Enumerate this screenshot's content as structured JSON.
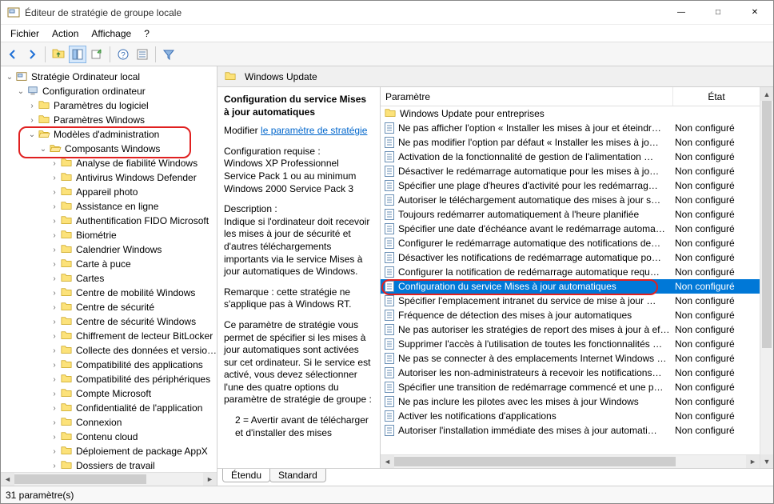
{
  "window": {
    "title": "Éditeur de stratégie de groupe locale"
  },
  "menu": {
    "items": [
      "Fichier",
      "Action",
      "Affichage",
      "?"
    ]
  },
  "tree": {
    "root": "Stratégie Ordinateur local",
    "config_computer": "Configuration ordinateur",
    "params_logiciel": "Paramètres du logiciel",
    "params_windows": "Paramètres Windows",
    "modeles_admin": "Modèles d'administration",
    "composants_windows": "Composants Windows",
    "children": [
      "Analyse de fiabilité Windows",
      "Antivirus Windows Defender",
      "Appareil photo",
      "Assistance en ligne",
      "Authentification FIDO Microsoft",
      "Biométrie",
      "Calendrier Windows",
      "Carte à puce",
      "Cartes",
      "Centre de mobilité Windows",
      "Centre de sécurité",
      "Centre de sécurité Windows",
      "Chiffrement de lecteur BitLocker",
      "Collecte des données et versions",
      "Compatibilité des applications",
      "Compatibilité des périphériques",
      "Compte Microsoft",
      "Confidentialité de l'application",
      "Connexion",
      "Contenu cloud",
      "Déploiement de package AppX",
      "Dossiers de travail"
    ]
  },
  "right": {
    "header": "Windows Update",
    "desc_title": "Configuration du service Mises à jour automatiques",
    "edit_label": "Modifier",
    "edit_link": "le paramètre de stratégie",
    "req_label": "Configuration requise :",
    "req_text": "Windows XP Professionnel Service Pack 1 ou au minimum Windows 2000 Service Pack 3",
    "descr_label": "Description :",
    "descr_text": "Indique si l'ordinateur doit recevoir les mises à jour de sécurité et d'autres téléchargements importants via le service Mises à jour automatiques de Windows.",
    "note_text": "Remarque : cette stratégie ne s'applique pas à Windows RT.",
    "extra_text": "Ce paramètre de stratégie vous permet de spécifier si les mises à jour automatiques sont activées sur cet ordinateur. Si le service est activé, vous devez sélectionner l'une des quatre options du paramètre de stratégie de groupe :",
    "option2": "2 = Avertir avant de télécharger et d'installer des mises"
  },
  "columns": {
    "param": "Paramètre",
    "state": "État"
  },
  "list": {
    "folder_row": "Windows Update pour entreprises",
    "state_nc": "Non configuré",
    "rows": [
      "Ne pas afficher l'option « Installer les mises à jour et éteindr…",
      "Ne pas modifier l'option par défaut « Installer les mises à jo…",
      "Activation de la fonctionnalité de gestion de l'alimentation …",
      "Désactiver le redémarrage automatique pour les mises à jo…",
      "Spécifier une plage d'heures d'activité pour les redémarrag…",
      "Autoriser le téléchargement automatique des mises à jour s…",
      "Toujours redémarrer automatiquement à l'heure planifiée",
      "Spécifier une date d'échéance avant le redémarrage automa…",
      "Configurer le redémarrage automatique des notifications de…",
      "Désactiver les notifications de redémarrage automatique po…",
      "Configurer la notification de redémarrage automatique requ…",
      "Configuration du service Mises à jour automatiques",
      "Spécifier l'emplacement intranet du service de mise à jour …",
      "Fréquence de détection des mises à jour automatiques",
      "Ne pas autoriser les stratégies de report des mises à jour à ef…",
      "Supprimer l'accès à l'utilisation de toutes les fonctionnalités …",
      "Ne pas se connecter à des emplacements Internet Windows …",
      "Autoriser les non-administrateurs à recevoir les notifications…",
      "Spécifier une transition de redémarrage commencé et une p…",
      "Ne pas inclure les pilotes avec les mises à jour Windows",
      "Activer les notifications d'applications",
      "Autoriser l'installation immédiate des mises à jour automati…"
    ],
    "selected_index": 11
  },
  "tabs": {
    "extended": "Étendu",
    "standard": "Standard"
  },
  "status": "31 paramètre(s)"
}
